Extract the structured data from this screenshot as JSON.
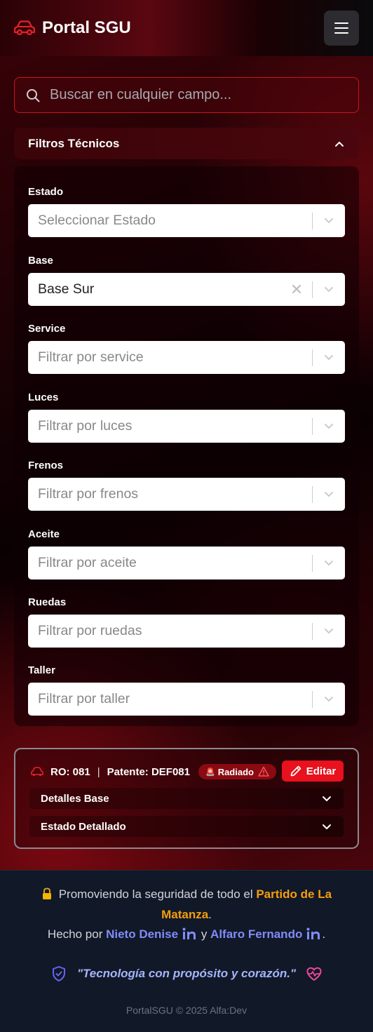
{
  "header": {
    "title": "Portal SGU"
  },
  "search": {
    "placeholder": "Buscar en cualquier campo..."
  },
  "filters": {
    "title": "Filtros Técnicos",
    "fields": [
      {
        "label": "Estado",
        "value": "Seleccionar Estado",
        "filled": false
      },
      {
        "label": "Base",
        "value": "Base Sur",
        "filled": true
      },
      {
        "label": "Service",
        "value": "Filtrar por service",
        "filled": false
      },
      {
        "label": "Luces",
        "value": "Filtrar por luces",
        "filled": false
      },
      {
        "label": "Frenos",
        "value": "Filtrar por frenos",
        "filled": false
      },
      {
        "label": "Aceite",
        "value": "Filtrar por aceite",
        "filled": false
      },
      {
        "label": "Ruedas",
        "value": "Filtrar por ruedas",
        "filled": false
      },
      {
        "label": "Taller",
        "value": "Filtrar por taller",
        "filled": false
      }
    ]
  },
  "vehicle": {
    "ro": "RO: 081",
    "separator": "|",
    "patente": "Patente: DEF081",
    "badge": "Radiado",
    "badge_icon": "🚨",
    "edit_label": "Editar",
    "sections": [
      "Detalles Base",
      "Estado Detallado"
    ]
  },
  "footer": {
    "line1_prefix": "Promoviendo la seguridad de todo el",
    "line1_highlight": "Partido de La",
    "line2_highlight": "Matanza",
    "line2_suffix": ".",
    "line3_prefix": "Hecho por",
    "author1": "Nieto Denise",
    "conj": "y",
    "author2": "Alfaro Fernando",
    "line3_suffix": ".",
    "motto": "\"Tecnología con propósito y corazón.\"",
    "copyright": "PortalSGU © 2025 Alfa:Dev"
  },
  "colors": {
    "accent": "#e8111d",
    "footer_bg": "#111827",
    "highlight_orange": "#f59e0b",
    "author_blue": "#818cf8"
  }
}
